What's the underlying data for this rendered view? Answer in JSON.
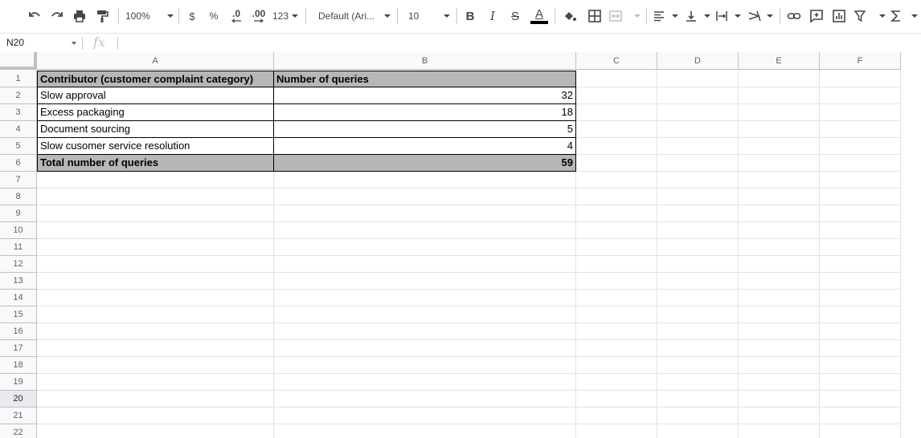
{
  "toolbar": {
    "zoom": "100%",
    "currency": "$",
    "percent": "%",
    "decrease_decimal": ".0",
    "increase_decimal": ".00",
    "number_format": "123",
    "font_family": "Default (Ari...",
    "font_size": "10",
    "bold": "B",
    "italic": "I",
    "strikethrough": "S",
    "text_color": "A",
    "text_color_value": "#000000"
  },
  "formula_bar": {
    "name_box": "N20",
    "fx": "fx",
    "formula": ""
  },
  "columns": [
    "A",
    "B",
    "C",
    "D",
    "E",
    "F"
  ],
  "rows": [
    "1",
    "2",
    "3",
    "4",
    "5",
    "6",
    "7",
    "8",
    "9",
    "10",
    "11",
    "12",
    "13",
    "14",
    "15",
    "16",
    "17",
    "18",
    "19",
    "20",
    "21",
    "22"
  ],
  "active_row": "20",
  "table": {
    "header": [
      "Contributor (customer complaint category)",
      "Number of queries"
    ],
    "body": [
      [
        "Slow approval",
        "32"
      ],
      [
        "Excess packaging",
        "18"
      ],
      [
        "Document sourcing",
        "5"
      ],
      [
        "Slow cusomer service resolution",
        "4"
      ]
    ],
    "total": [
      "Total number of queries",
      "59"
    ],
    "header_fill": "#b7b7b7"
  }
}
